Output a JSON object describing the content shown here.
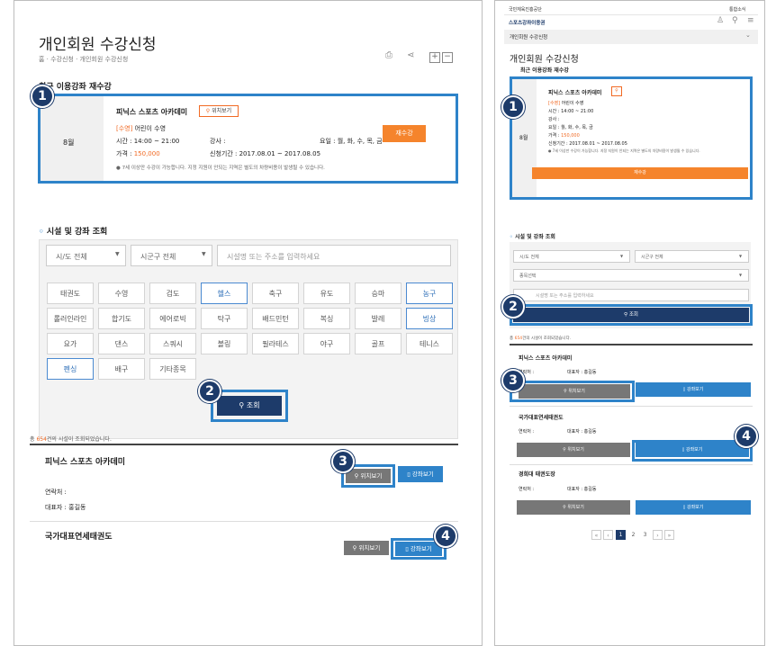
{
  "left": {
    "title": "개인회원 수강신청",
    "breadcrumb": "홈 · 수강신청 · 개인회원 수강신청",
    "recent_title": "최근 이용강좌 재수강",
    "course": {
      "month": "8월",
      "name": "피닉스 스포츠 아카데미",
      "location_btn": "위치보기",
      "category_tag": "[수영]",
      "category_name": "어린이 수영",
      "time": "시간 : 14:00 ~ 21:00",
      "instructor": "강사 :",
      "days": "요일 : 월, 화, 수, 목, 금",
      "price_label": "가격 :",
      "price_value": "150,000",
      "period": "신청기간 : 2017.08.01 ~ 2017.08.05",
      "note": "7세 이상만 수강이 가능합니다. 지정 지원이 안되는 지역은 별도의 차량비용이 발생될 수 있습니다.",
      "retake_btn": "재수강"
    },
    "search_title": "시설 및 강좌 조회",
    "select_city": "시/도 전체",
    "select_district": "시군구 전체",
    "search_placeholder": "시설명 또는 주소를 입력하세요",
    "categories": [
      "태권도",
      "수영",
      "검도",
      "헬스",
      "축구",
      "유도",
      "승마",
      "농구",
      "롤러인라인",
      "합기도",
      "에어로빅",
      "탁구",
      "배드민턴",
      "복싱",
      "발레",
      "빙상",
      "요가",
      "댄스",
      "스쿼시",
      "볼링",
      "필라테스",
      "야구",
      "골프",
      "테니스",
      "펜싱",
      "배구",
      "기타종목"
    ],
    "search_btn": "조회",
    "result_prefix": "총 ",
    "result_count": "654",
    "result_suffix": "건의 시설이 조회되었습니다.",
    "results": [
      {
        "name": "피닉스 스포츠 아카데미",
        "contact": "연락처 :",
        "rep": "대표자 : 홍길동",
        "loc_btn": "위치보기",
        "course_btn": "강좌보기"
      },
      {
        "name": "국가대표연세태권도",
        "loc_btn": "위치보기",
        "course_btn": "강좌보기"
      }
    ]
  },
  "right": {
    "org": "국민체육진흥공단",
    "lang": "통합소식",
    "site": "스포츠강좌이용권",
    "menu": "개인회원 수강신청",
    "title": "개인회원 수강신청",
    "recent_title": "최근 이용강좌 재수강",
    "course": {
      "month": "8월",
      "name": "피닉스 스포츠 아카데미",
      "category_tag": "[수영]",
      "category_name": "어린이 수영",
      "time": "시간 : 14:00 ~ 21:00",
      "instructor": "강사 :",
      "days": "요일 : 월, 화, 수, 목, 금",
      "price_label": "가격 :",
      "price_value": "150,000",
      "period": "신청기간 : 2017.08.01 ~ 2017.08.05",
      "note": "7세 이상만 수강이 가능합니다. 지정 지원이 안되는 지역은 별도의 차량비용이 발생될 수 있습니다.",
      "retake_btn": "재수강"
    },
    "search_title": "시설 및 강좌 조회",
    "select_city": "시/도 전체",
    "select_district": "시군구 전체",
    "select_sport": "종목선택",
    "search_placeholder": "시설명 또는 주소를 입력하세요",
    "search_btn": "조회",
    "result_prefix": "총 ",
    "result_count": "654",
    "result_suffix": "건의 시설이 조회되었습니다.",
    "results": [
      {
        "name": "피닉스 스포츠 아카데미",
        "contact": "연락처 :",
        "rep": "대표자 : 홍길동",
        "loc_btn": "위치보기",
        "course_btn": "강좌보기"
      },
      {
        "name": "국가대표연세태권도",
        "contact": "연락처 :",
        "rep": "대표자 : 홍길동",
        "loc_btn": "위치보기",
        "course_btn": "강좌보기"
      },
      {
        "name": "경희대 태권도장",
        "contact": "연락처 :",
        "rep": "대표자 : 홍길동",
        "loc_btn": "위치보기",
        "course_btn": "강좌보기"
      }
    ],
    "pages": [
      "1",
      "2",
      "3"
    ]
  },
  "badges": [
    "1",
    "2",
    "3",
    "4"
  ],
  "colors": {
    "accent": "#2e83c9",
    "orange": "#f16a24",
    "navy": "#1d3b6a",
    "gray_btn": "#777777"
  }
}
